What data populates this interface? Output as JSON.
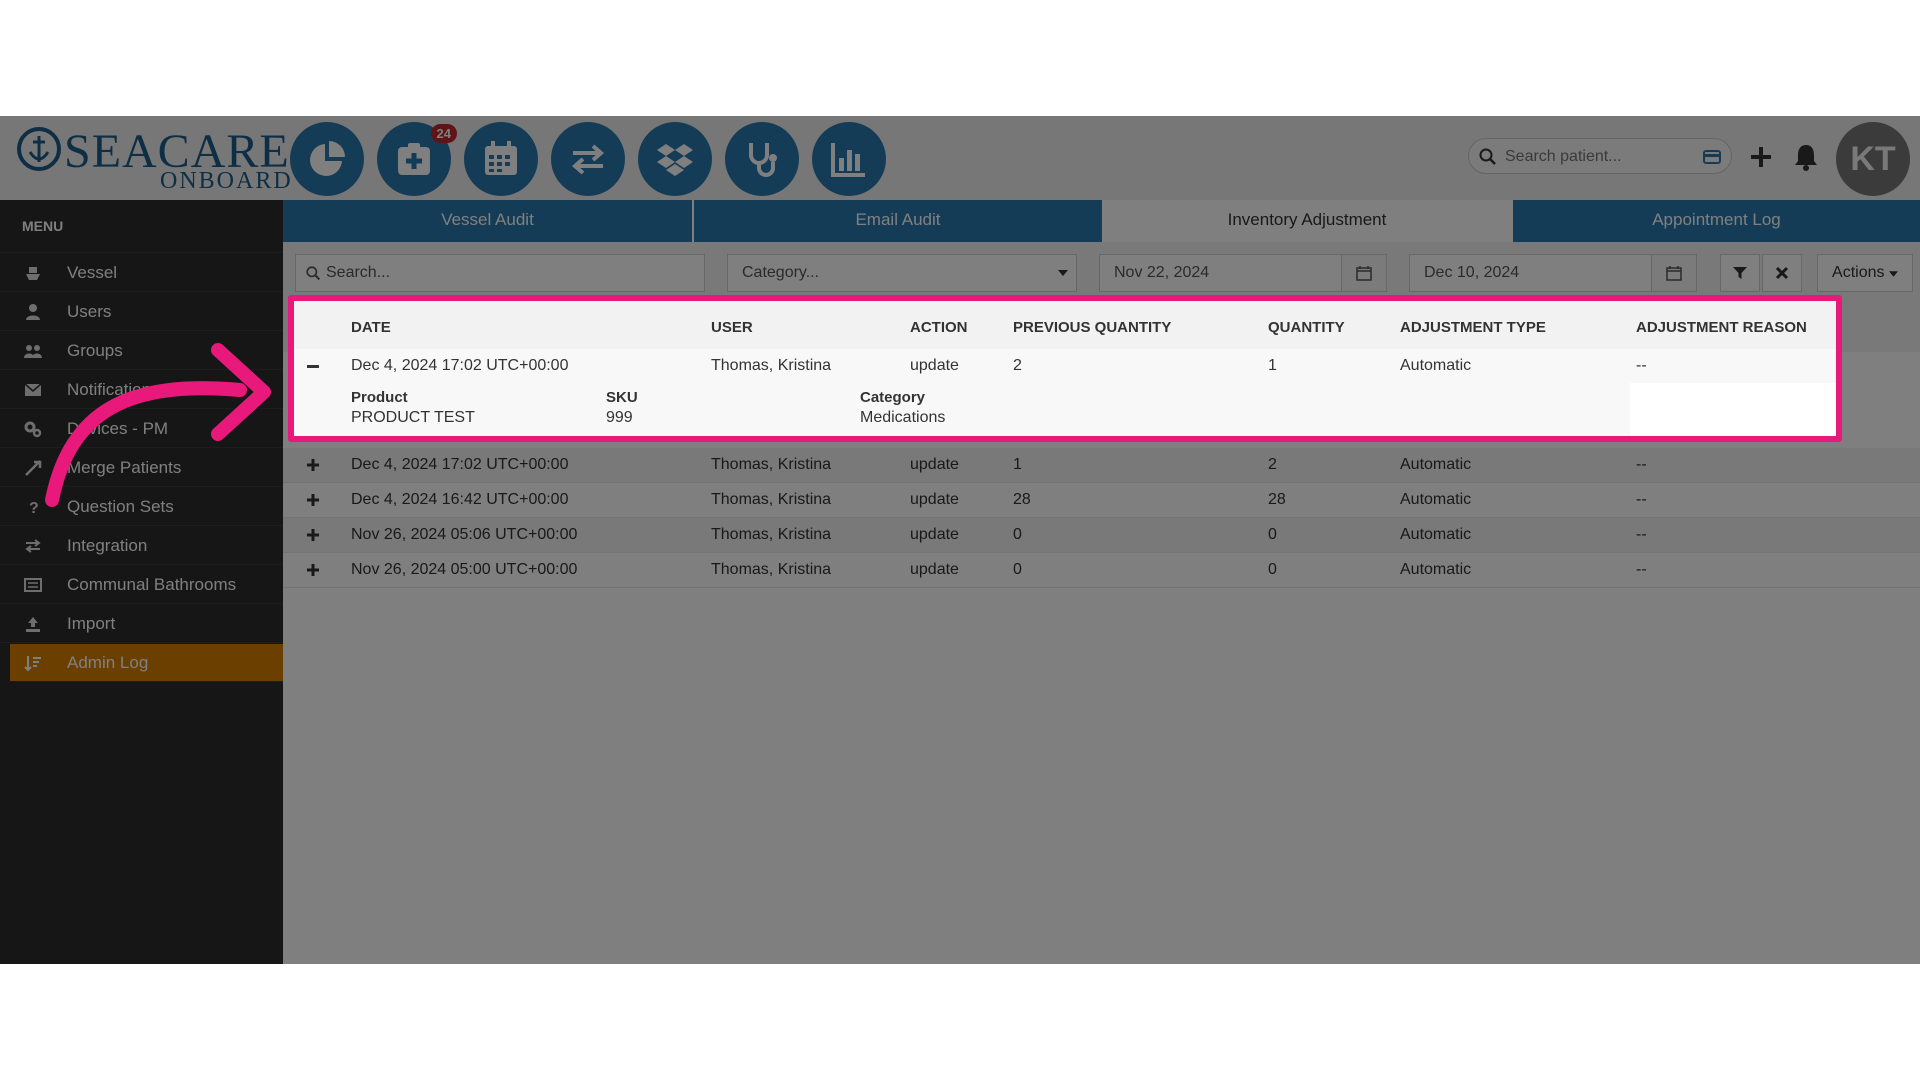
{
  "header": {
    "logo_top": "SEACARE",
    "logo_bottom": "ONBOARD",
    "notification_count": "24",
    "search_placeholder": "Search patient...",
    "avatar_initials": "KT"
  },
  "sidebar": {
    "title": "MENU",
    "items": [
      {
        "label": "Vessel",
        "icon": "ship-icon"
      },
      {
        "label": "Users",
        "icon": "user-icon"
      },
      {
        "label": "Groups",
        "icon": "users-icon"
      },
      {
        "label": "Notifications",
        "icon": "envelope-icon"
      },
      {
        "label": "Devices - PM",
        "icon": "gears-icon"
      },
      {
        "label": "Merge Patients",
        "icon": "merge-icon"
      },
      {
        "label": "Question Sets",
        "icon": "question-icon"
      },
      {
        "label": "Integration",
        "icon": "exchange-icon"
      },
      {
        "label": "Communal Bathrooms",
        "icon": "list-icon"
      },
      {
        "label": "Import",
        "icon": "upload-icon"
      },
      {
        "label": "Admin Log",
        "icon": "sort-icon"
      }
    ],
    "active": "Admin Log"
  },
  "tabs": [
    {
      "label": "Vessel Audit"
    },
    {
      "label": "Email Audit"
    },
    {
      "label": "Inventory Adjustment"
    },
    {
      "label": "Appointment Log"
    }
  ],
  "active_tab": "Inventory Adjustment",
  "filters": {
    "search_placeholder": "Search...",
    "category_placeholder": "Category...",
    "date_from": "Nov 22, 2024",
    "date_to": "Dec 10, 2024",
    "actions_label": "Actions"
  },
  "table": {
    "columns": [
      "DATE",
      "USER",
      "ACTION",
      "PREVIOUS QUANTITY",
      "QUANTITY",
      "ADJUSTMENT TYPE",
      "ADJUSTMENT REASON"
    ],
    "rows": [
      {
        "date": "Dec 4, 2024 17:02 UTC+00:00",
        "user": "Thomas, Kristina",
        "action": "update",
        "prev": "2",
        "qty": "1",
        "type": "Automatic",
        "reason": "--",
        "expanded": true
      },
      {
        "date": "Dec 4, 2024 17:02 UTC+00:00",
        "user": "Thomas, Kristina",
        "action": "update",
        "prev": "1",
        "qty": "2",
        "type": "Automatic",
        "reason": "--"
      },
      {
        "date": "Dec 4, 2024 16:42 UTC+00:00",
        "user": "Thomas, Kristina",
        "action": "update",
        "prev": "28",
        "qty": "28",
        "type": "Automatic",
        "reason": "--"
      },
      {
        "date": "Nov 26, 2024 05:06 UTC+00:00",
        "user": "Thomas, Kristina",
        "action": "update",
        "prev": "0",
        "qty": "0",
        "type": "Automatic",
        "reason": "--"
      },
      {
        "date": "Nov 26, 2024 05:00 UTC+00:00",
        "user": "Thomas, Kristina",
        "action": "update",
        "prev": "0",
        "qty": "0",
        "type": "Automatic",
        "reason": "--"
      }
    ],
    "detail": {
      "product_label": "Product",
      "product_value": "PRODUCT TEST",
      "sku_label": "SKU",
      "sku_value": "999",
      "category_label": "Category",
      "category_value": "Medications"
    }
  },
  "colors": {
    "brand_blue": "#2a79ad",
    "accent_orange": "#d47f00",
    "highlight_pink": "#e8197a",
    "badge_red": "#c0282d"
  }
}
